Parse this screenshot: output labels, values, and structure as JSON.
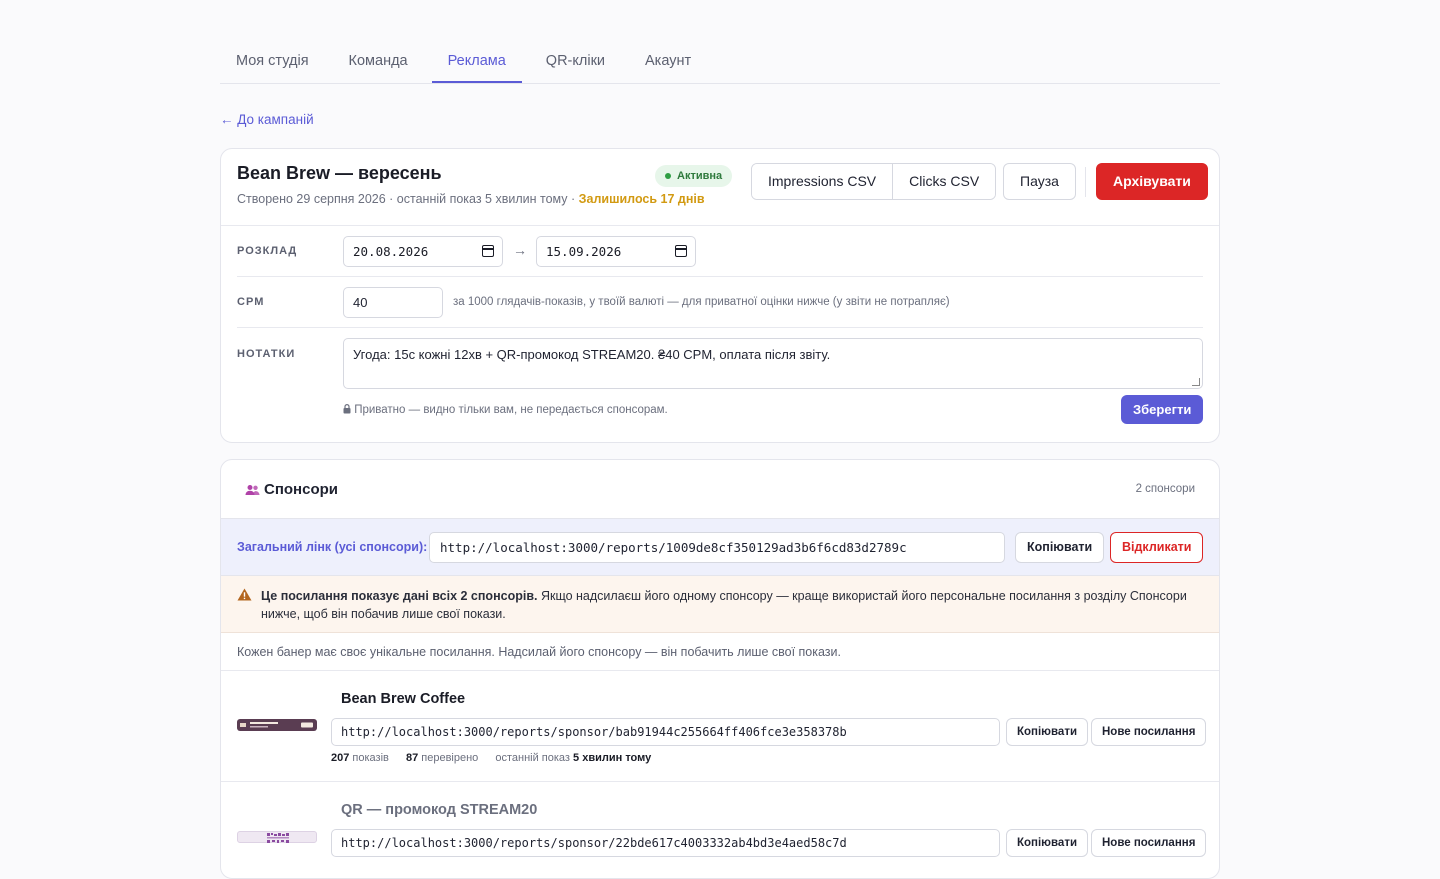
{
  "tabs": [
    {
      "label": "Моя студія",
      "active": false
    },
    {
      "label": "Команда",
      "active": false
    },
    {
      "label": "Реклама",
      "active": true
    },
    {
      "label": "QR-кліки",
      "active": false
    },
    {
      "label": "Акаунт",
      "active": false
    }
  ],
  "back_link": "← До кампаній",
  "campaign": {
    "title": "Bean Brew — вересень",
    "subtitle": "Створено 29 серпня 2026 · останній показ 5 хвилин тому ·",
    "remaining": "Залишилось 17 днів",
    "status": "Активна",
    "buttons": {
      "impressions_csv": "Impressions CSV",
      "clicks_csv": "Clicks CSV",
      "pause": "Пауза",
      "archive": "Архівувати"
    }
  },
  "schedule": {
    "label": "РОЗКЛАД",
    "start": "20.08.2026",
    "arrow": "→",
    "end": "15.09.2026"
  },
  "cpm": {
    "label": "CPM",
    "value": "40",
    "hint": "за 1000 глядачів-показів, у твоїй валюті — для приватної оцінки нижче (у звіти не потрапляє)"
  },
  "notes": {
    "label": "НОТАТКИ",
    "value": "Угода: 15с кожні 12хв + QR-промокод STREAM20. ₴40 CPM, оплата після звіту.",
    "private_hint": "Приватно — видно тільки вам, не передається спонсорам.",
    "save": "Зберегти"
  },
  "sponsors": {
    "title": "Спонсори",
    "count": "2 спонсори",
    "shared_label": "Загальний лінк (усі спонсори):",
    "shared_link": "http://localhost:3000/reports/1009de8cf350129ad3b6f6cd83d2789c",
    "copy": "Копіювати",
    "revoke": "Відкликати",
    "warning_bold": "Це посилання показує дані всіх 2 спонсорів.",
    "warning_text": " Якщо надсилаєш його одному спонсору — краще використай його персональне посилання з розділу Спонсори нижче, щоб він побачив лише свої покази.",
    "info": "Кожен банер має своє унікальне посилання. Надсилай його спонсору — він побачить лише свої покази.",
    "items": [
      {
        "name": "Bean Brew Coffee",
        "link": "http://localhost:3000/reports/sponsor/bab91944c255664ff406fce3e358378b",
        "copy": "Копіювати",
        "new_link": "Нове посилання",
        "shows": "207",
        "shows_label": "показів",
        "verified": "87",
        "verified_label": "перевірено",
        "last_label": "останній показ",
        "last_value": "5 хвилин тому"
      },
      {
        "name": "QR — промокод STREAM20",
        "link": "http://localhost:3000/reports/sponsor/22bde617c4003332ab4bd3e4aed58c7d",
        "copy": "Копіювати",
        "new_link": "Нове посилання"
      }
    ]
  },
  "colors": {
    "accent": "#5b5bd6",
    "danger": "#dc2626",
    "warning_text": "#d29a12",
    "active_badge": "#2f7a3d"
  }
}
